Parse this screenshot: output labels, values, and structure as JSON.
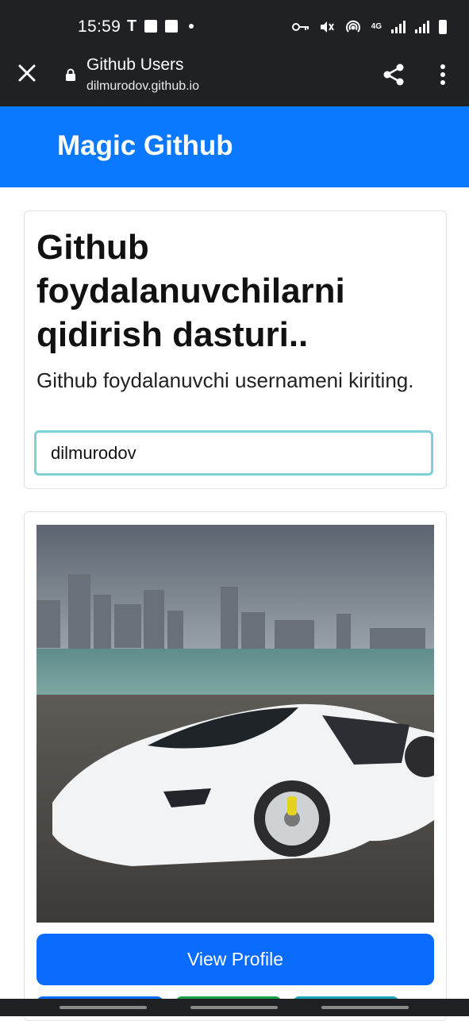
{
  "status_bar": {
    "time": "15:59",
    "notif_letter": "T",
    "network": "4G"
  },
  "browser": {
    "title": "Github Users",
    "url": "dilmurodov.github.io",
    "close_icon": "close-icon",
    "share_icon": "share-icon",
    "menu_icon": "more-vertical-icon"
  },
  "navbar": {
    "brand": "Magic Github",
    "color": "#0a78ff"
  },
  "search_card": {
    "heading": "Github foydalanuvchilarni qidirish dasturi..",
    "lead": "Github foydalanuvchi usernameni kiriting.",
    "input_value": "dilmurodov"
  },
  "user_card": {
    "avatar_desc": "white sports car",
    "view_profile_label": "View Profile",
    "button_color": "#0a6bff"
  }
}
